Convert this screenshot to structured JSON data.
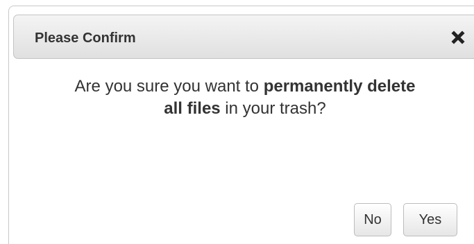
{
  "dialog": {
    "title": "Please Confirm",
    "close_icon": "close-icon",
    "message": {
      "part1": "Are you sure you want to ",
      "bold1": "permanently delete",
      "bold2": "all files",
      "part2": " in your trash?"
    },
    "buttons": {
      "no_label": "No",
      "yes_label": "Yes"
    }
  }
}
